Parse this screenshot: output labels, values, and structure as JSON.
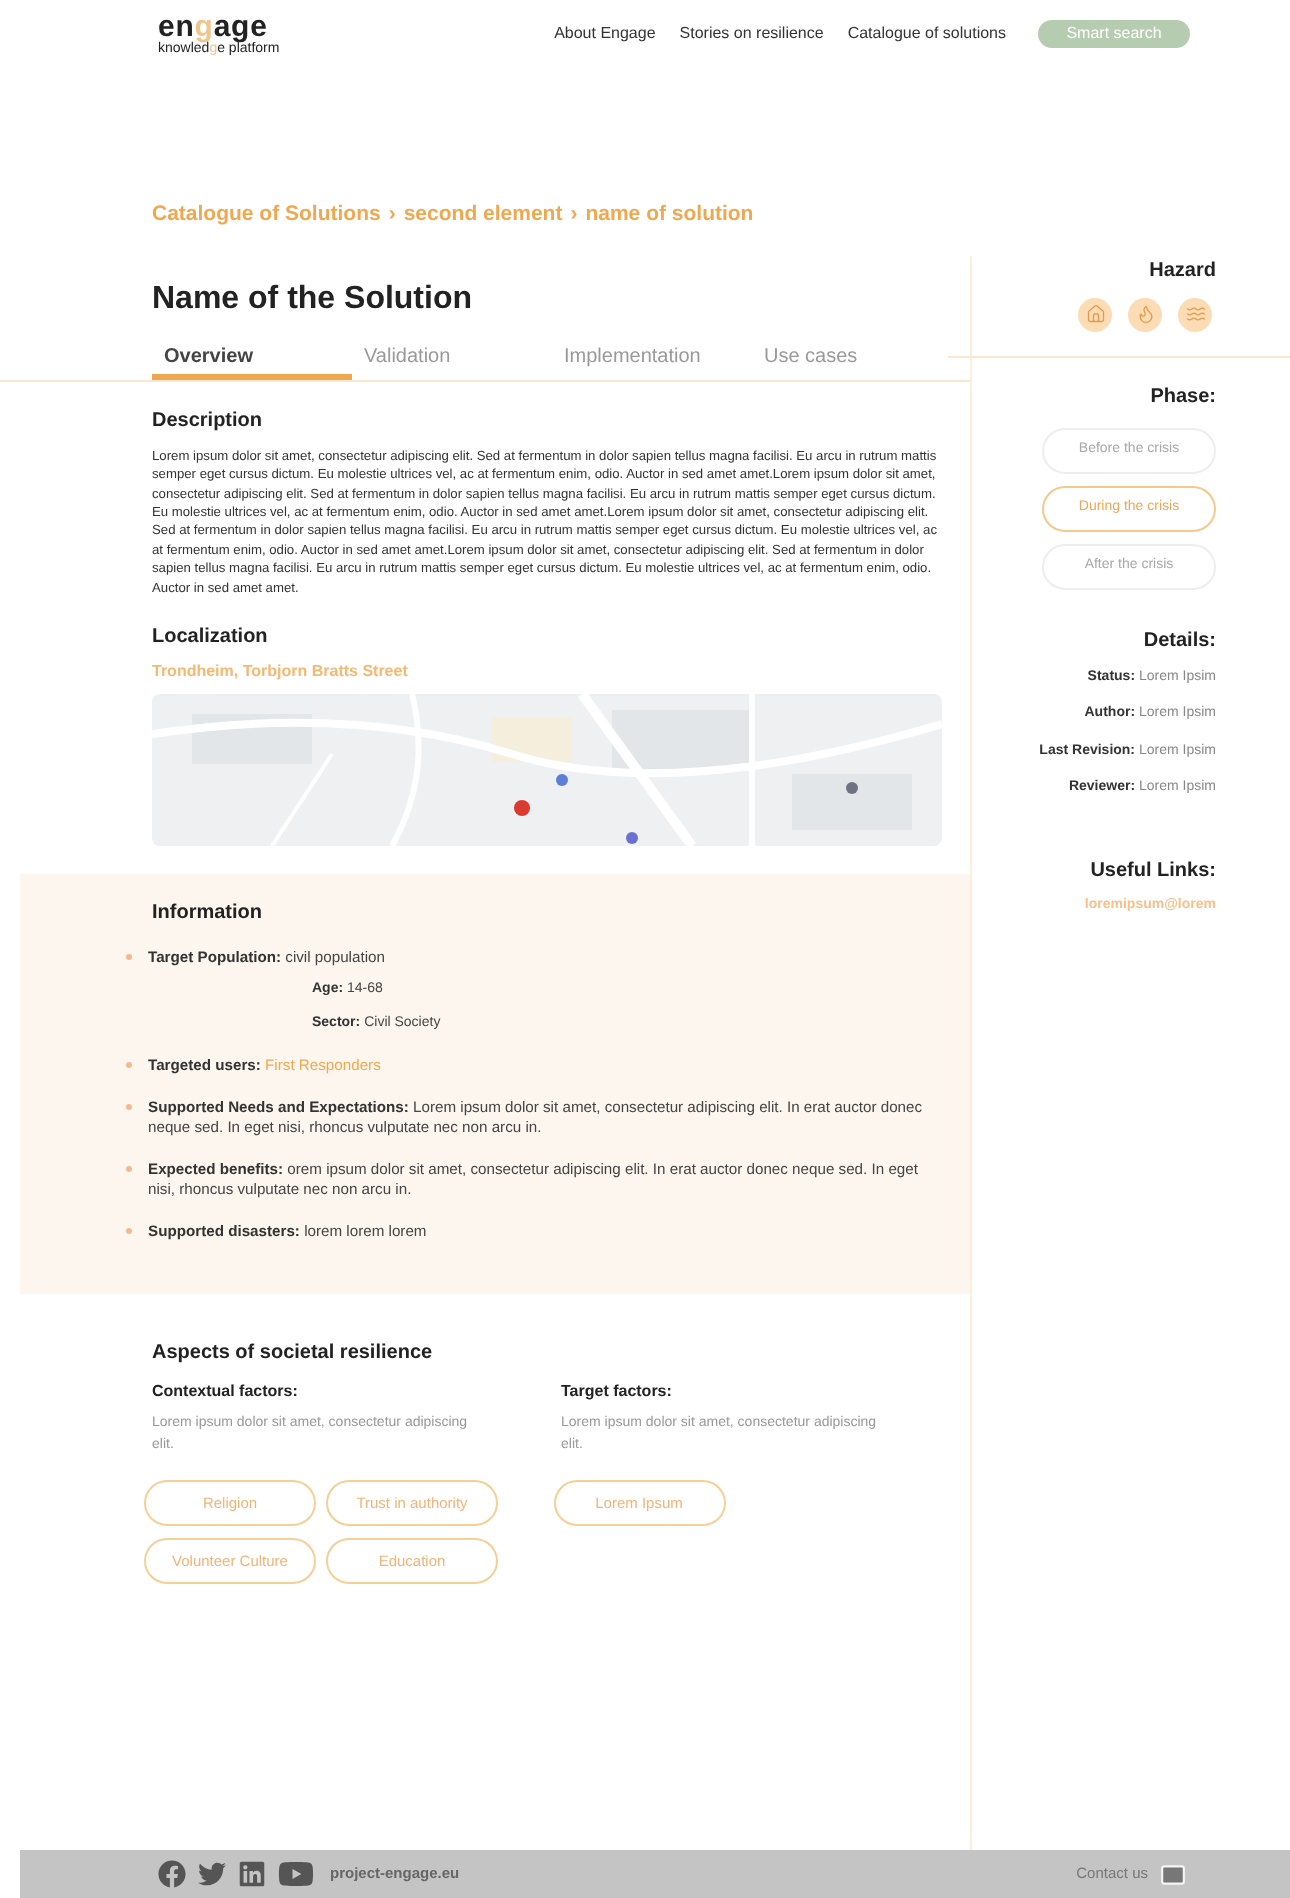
{
  "logo": {
    "word": [
      {
        "text": "en",
        "accent": false
      },
      {
        "text": "g",
        "accent": true
      },
      {
        "text": "age",
        "accent": false
      }
    ],
    "tagline": [
      {
        "text": "knowled",
        "accent": false
      },
      {
        "text": "g",
        "accent": true
      },
      {
        "text": "e platform",
        "accent": false
      }
    ]
  },
  "nav": {
    "links": [
      "About Engage",
      "Stories on resilience",
      "Catalogue of solutions"
    ],
    "button": "Smart search"
  },
  "breadcrumb": [
    "Catalogue of Solutions",
    "second element",
    "name of solution"
  ],
  "breadcrumb_separator": "›",
  "title": "Name of the Solution",
  "tabs": [
    {
      "label": "Overview",
      "selected": true
    },
    {
      "label": "Validation",
      "selected": false
    },
    {
      "label": "Implementation",
      "selected": false
    },
    {
      "label": "Use cases",
      "selected": false
    }
  ],
  "description": {
    "heading": "Description",
    "text": "Lorem ipsum dolor sit amet, consectetur adipiscing elit. Sed at fermentum in dolor sapien tellus magna facilisi. Eu arcu in rutrum mattis semper eget cursus dictum. Eu molestie ultrices vel, ac at fermentum enim, odio. Auctor in sed amet amet.Lorem ipsum dolor sit amet, consectetur adipiscing elit. Sed at fermentum in dolor sapien tellus magna facilisi. Eu arcu in rutrum mattis semper eget cursus dictum. Eu molestie ultrices vel, ac at fermentum enim, odio. Auctor in sed amet amet.Lorem ipsum dolor sit amet, consectetur adipiscing elit. Sed at fermentum in dolor sapien tellus magna facilisi. Eu arcu in rutrum mattis semper eget cursus dictum. Eu molestie ultrices vel, ac at fermentum enim, odio. Auctor in sed amet amet.Lorem ipsum dolor sit amet, consectetur adipiscing elit. Sed at fermentum in dolor sapien tellus magna facilisi. Eu arcu in rutrum mattis semper eget cursus dictum. Eu molestie ultrices vel, ac at fermentum enim, odio. Auctor in sed amet amet."
  },
  "localization": {
    "heading": "Localization",
    "address": "Trondheim, Torbjorn Bratts Street"
  },
  "information": {
    "heading": "Information",
    "items": [
      {
        "label": "Target Population:",
        "value": "civil population",
        "accent": false,
        "children": [
          {
            "label": "Age:",
            "value": "14-68"
          },
          {
            "label": "Sector:",
            "value": "Civil Society"
          }
        ]
      },
      {
        "label": "Targeted users:",
        "value": "First Responders",
        "accent": true
      },
      {
        "label": "Supported Needs and Expectations:",
        "value": "Lorem ipsum dolor sit amet, consectetur adipiscing elit. In erat auctor donec neque sed. In eget nisi, rhoncus vulputate nec non arcu in.",
        "accent": false
      },
      {
        "label": "Expected benefits:",
        "value": "orem ipsum dolor sit amet, consectetur adipiscing elit. In erat auctor donec neque sed. In eget nisi, rhoncus vulputate nec non arcu in.",
        "accent": false
      },
      {
        "label": "Supported disasters:",
        "value": "lorem lorem lorem",
        "accent": false
      }
    ]
  },
  "aspects": {
    "heading": "Aspects of societal resilience",
    "groups": [
      {
        "heading": "Contextual factors:",
        "text": "Lorem ipsum dolor sit amet, consectetur adipiscing elit.",
        "tags": [
          "Religion",
          "Trust in authority",
          "Volunteer Culture",
          "Education"
        ]
      },
      {
        "heading": "Target factors:",
        "text": "Lorem ipsum dolor sit amet, consectetur adipiscing elit.",
        "tags": [
          "Lorem Ipsum"
        ]
      }
    ]
  },
  "hazard": {
    "heading": "Hazard"
  },
  "phase": {
    "heading": "Phase:",
    "options": [
      {
        "label": "Before the crisis",
        "selected": false
      },
      {
        "label": "During the crisis",
        "selected": true
      },
      {
        "label": "After the crisis",
        "selected": false
      }
    ]
  },
  "details": {
    "heading": "Details:",
    "rows": [
      {
        "label": "Status:",
        "value": "Lorem Ipsim"
      },
      {
        "label": "Author:",
        "value": "Lorem Ipsim"
      },
      {
        "label": "Last Revision:",
        "value": "Lorem Ipsim"
      },
      {
        "label": "Reviewer:",
        "value": "Lorem Ipsim"
      }
    ]
  },
  "links": {
    "heading": "Useful Links:",
    "items": [
      "loremipsum@lorem"
    ]
  },
  "footer": {
    "site": "project-engage.eu",
    "contact": "Contact us"
  }
}
